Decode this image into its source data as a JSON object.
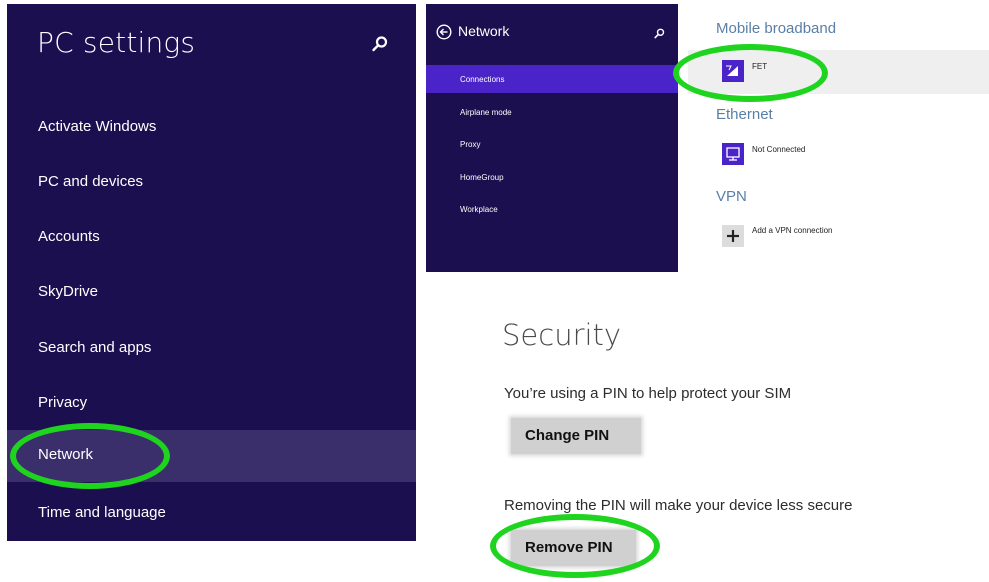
{
  "pc_settings": {
    "title": "PC settings",
    "items": [
      {
        "label": "Activate Windows"
      },
      {
        "label": "PC and devices"
      },
      {
        "label": "Accounts"
      },
      {
        "label": "SkyDrive"
      },
      {
        "label": "Search and apps"
      },
      {
        "label": "Privacy"
      },
      {
        "label": "Network",
        "selected": true
      },
      {
        "label": "Time and language"
      }
    ]
  },
  "network": {
    "title": "Network",
    "items": [
      {
        "label": "Connections",
        "selected": true
      },
      {
        "label": "Airplane mode"
      },
      {
        "label": "Proxy"
      },
      {
        "label": "HomeGroup"
      },
      {
        "label": "Workplace"
      }
    ]
  },
  "connections": {
    "mobile_broadband_heading": "Mobile broadband",
    "mobile_broadband_item": "FET",
    "ethernet_heading": "Ethernet",
    "ethernet_item": "Not Connected",
    "vpn_heading": "VPN",
    "vpn_item": "Add a VPN connection"
  },
  "security": {
    "title": "Security",
    "pin_text": "You’re using a PIN to help protect your SIM",
    "change_pin_label": "Change PIN",
    "remove_text": "Removing the PIN will make your device less secure",
    "remove_pin_label": "Remove PIN"
  },
  "colors": {
    "panel_bg": "#1b0f4f",
    "selected_item": "#4a24c8",
    "highlight_ring": "#1fd41f"
  }
}
